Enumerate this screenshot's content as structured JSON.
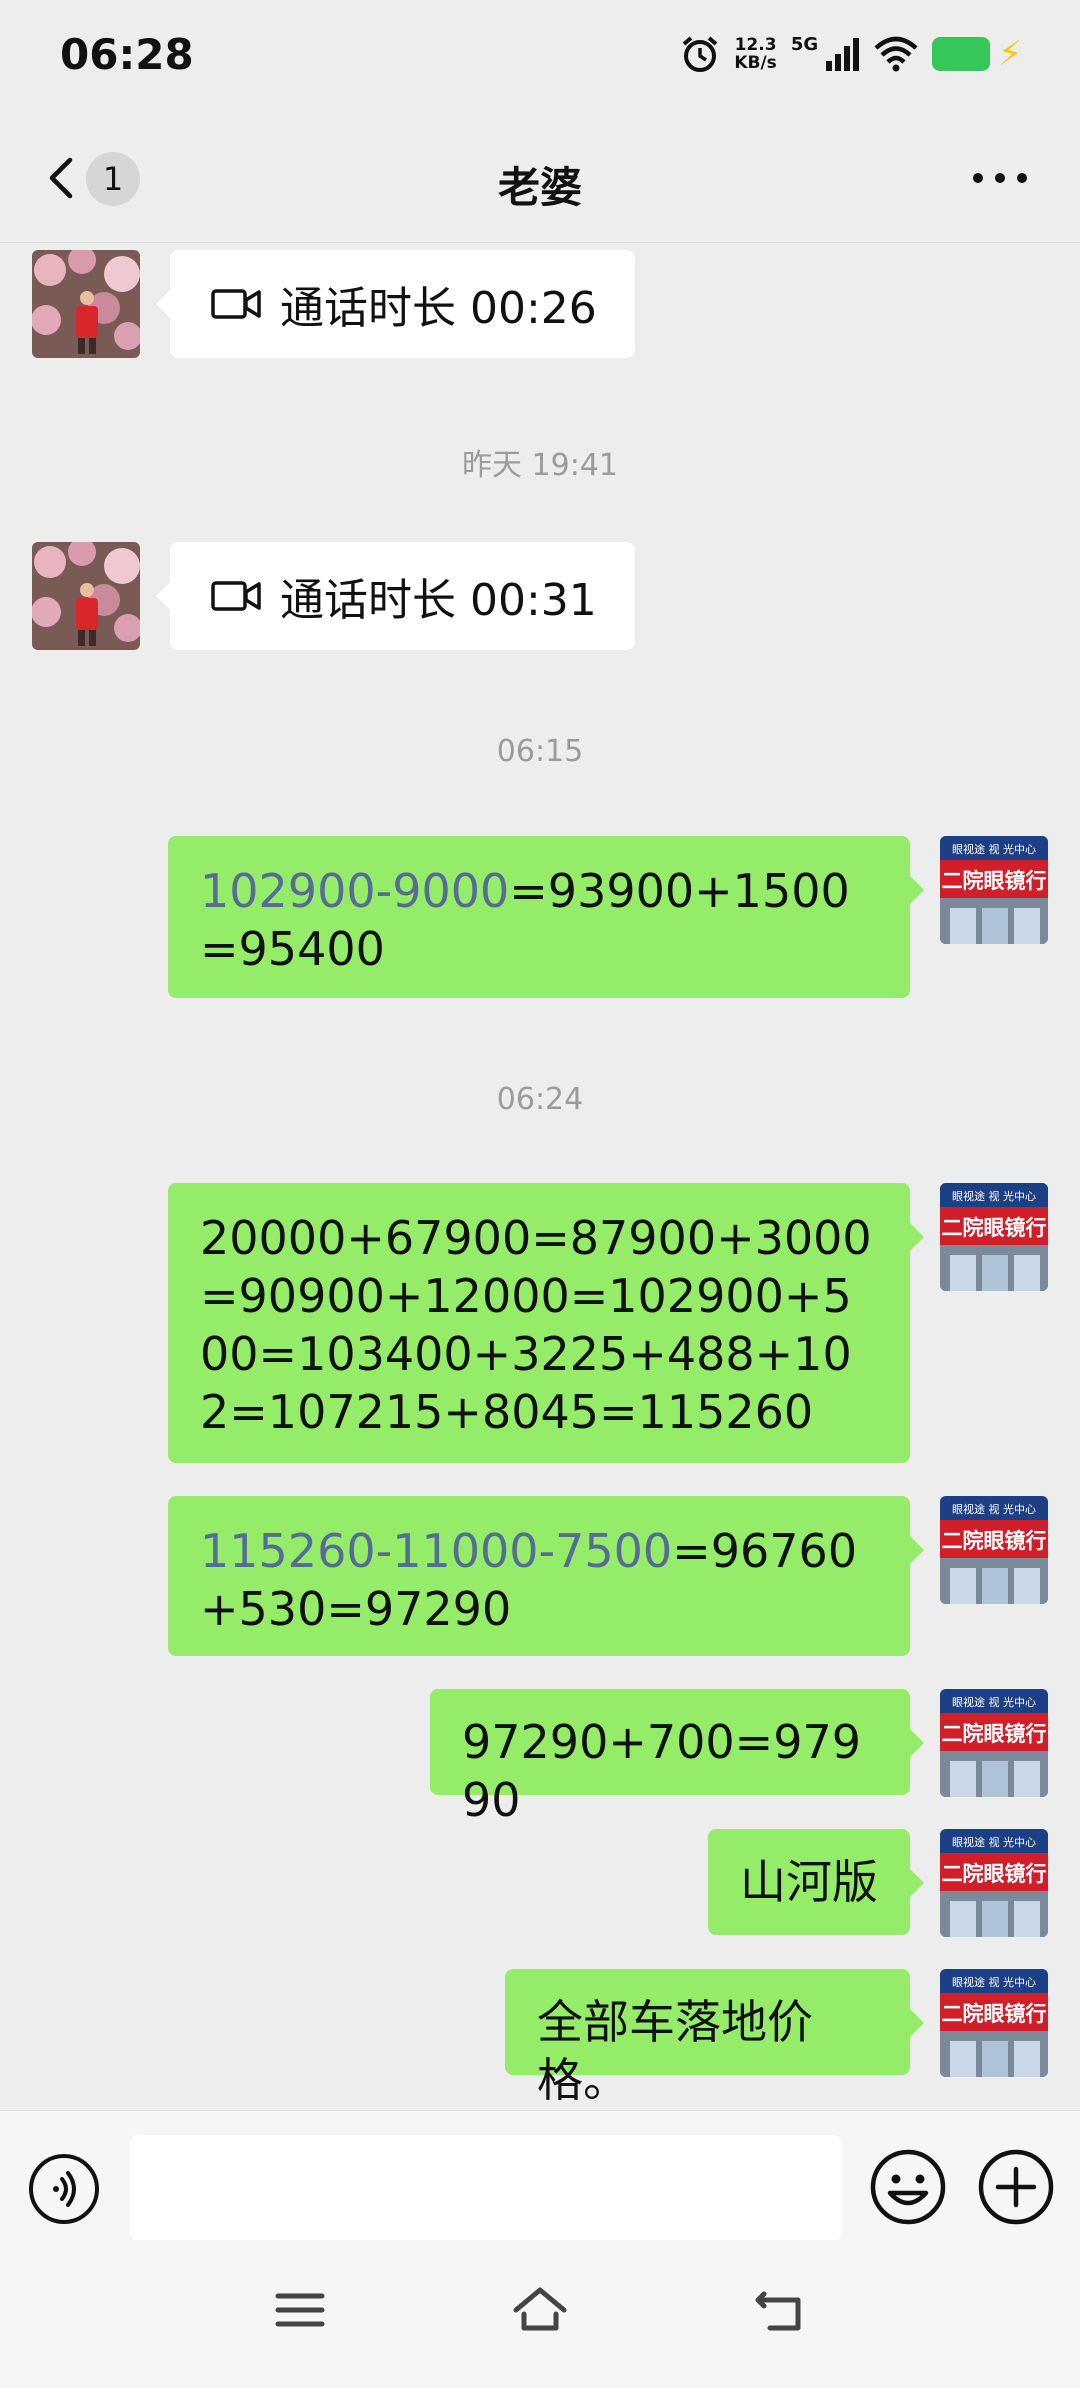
{
  "status_bar": {
    "time": "06:28",
    "net_speed_value": "12.3",
    "net_speed_unit": "KB/s",
    "network_type": "5G"
  },
  "header": {
    "unread_count": "1",
    "title": "老婆"
  },
  "messages": {
    "m1": {
      "label": "通话时长 00:26"
    },
    "ts1": "昨天 19:41",
    "m2": {
      "label": "通话时长 00:31"
    },
    "ts2": "06:15",
    "m3": {
      "link": "102900-9000",
      "rest": "=93900+1500=95400"
    },
    "ts3": "06:24",
    "m4": {
      "text": "20000+67900=87900+3000=90900+12000=102900+500=103400+3225+488+102=107215+8045=115260"
    },
    "m5": {
      "link": "115260-11000-7500",
      "rest": "=96760+530=97290"
    },
    "m6": {
      "text": "97290+700=97990"
    },
    "m7": {
      "text": "山河版"
    },
    "m8": {
      "text": "全部车落地价格。"
    }
  },
  "avatar_me": {
    "sign_top": "眼视途 视 光中心",
    "sign_main": "二院眼镜行"
  },
  "colors": {
    "outgoing_bubble": "#95ec69",
    "incoming_bubble": "#ffffff",
    "link": "#576b95",
    "background": "#ededed"
  },
  "icons": {
    "back": "chevron-left-icon",
    "more": "more-dots-icon",
    "video_call": "video-camera-icon",
    "voice": "voice-input-icon",
    "emoji": "emoji-icon",
    "plus": "plus-circle-icon"
  }
}
